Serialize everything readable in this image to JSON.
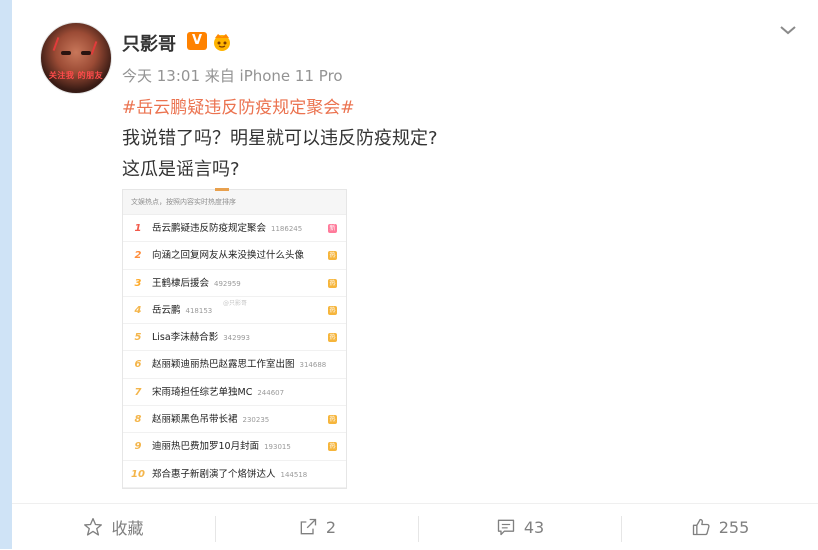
{
  "post": {
    "user_name": "只影哥",
    "verified_badge": "V",
    "avatar_text": "关注我 的朋友",
    "meta": "今天 13:01 来自 iPhone 11 Pro",
    "hashtag": "#岳云鹏疑违反防疫规定聚会#",
    "text_line1": "我说错了吗？明星就可以违反防疫规定?",
    "text_line2": "这瓜是谣言吗?"
  },
  "trend_image": {
    "header": "文娱热点，按照内容实时热度排序",
    "watermark": "@只影哥",
    "items": [
      {
        "rank": "1",
        "title": "岳云鹏疑违反防疫规定聚会",
        "count": "1186245",
        "badge": "新",
        "badge_color": "#ff7a9a",
        "rank_color": "#f25a4b"
      },
      {
        "rank": "2",
        "title": "向涵之回复网友从来没换过什么头像",
        "count": "",
        "badge": "热",
        "badge_color": "#f6b53b",
        "rank_color": "#ff8d3b"
      },
      {
        "rank": "3",
        "title": "王鹤棣后援会",
        "count": "492959",
        "badge": "热",
        "badge_color": "#f6b53b",
        "rank_color": "#ffab2a"
      },
      {
        "rank": "4",
        "title": "岳云鹏",
        "count": "418153",
        "badge": "热",
        "badge_color": "#f6b53b",
        "rank_color": "#f4b54a"
      },
      {
        "rank": "5",
        "title": "Lisa李沫赫合影",
        "count": "342993",
        "badge": "热",
        "badge_color": "#f6b53b",
        "rank_color": "#f4b54a"
      },
      {
        "rank": "6",
        "title": "赵丽颖迪丽热巴赵露思工作室出图",
        "count": "314688",
        "badge": "",
        "badge_color": "",
        "rank_color": "#f4b54a"
      },
      {
        "rank": "7",
        "title": "宋雨琦担任综艺单独MC",
        "count": "244607",
        "badge": "",
        "badge_color": "",
        "rank_color": "#f4b54a"
      },
      {
        "rank": "8",
        "title": "赵丽颖黑色吊带长裙",
        "count": "230235",
        "badge": "热",
        "badge_color": "#f6b53b",
        "rank_color": "#f4b54a"
      },
      {
        "rank": "9",
        "title": "迪丽热巴费加罗10月封面",
        "count": "193015",
        "badge": "热",
        "badge_color": "#f6b53b",
        "rank_color": "#f4b54a"
      },
      {
        "rank": "10",
        "title": "郑合惠子新剧演了个烙饼达人",
        "count": "144518",
        "badge": "",
        "badge_color": "",
        "rank_color": "#f4b54a"
      }
    ]
  },
  "footer": {
    "favorite_label": "收藏",
    "repost_count": "2",
    "comment_count": "43",
    "like_count": "255"
  },
  "icons": {
    "favorite": "star-outline-icon",
    "repost": "share-arrow-icon",
    "comment": "comment-bubble-icon",
    "like": "thumbs-up-icon",
    "more": "chevron-down-icon"
  },
  "colors": {
    "hashtag": "#eb7350",
    "verified": "#ff8200",
    "meta": "#939393"
  }
}
